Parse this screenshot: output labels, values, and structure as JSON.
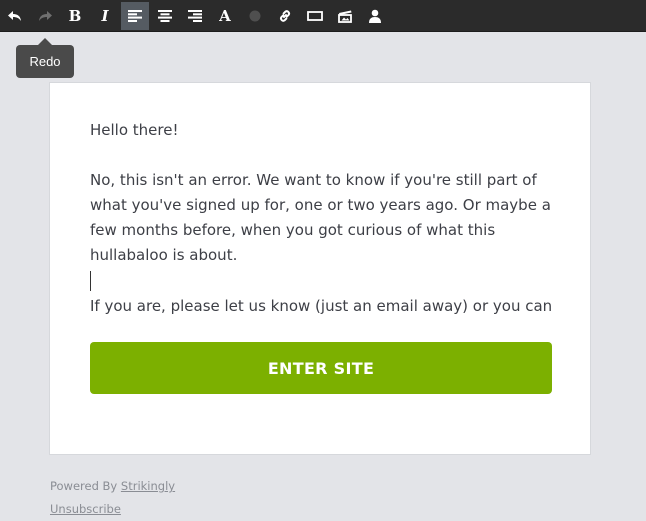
{
  "toolbar": {
    "buttons": [
      {
        "icon": "undo-icon",
        "state": "enabled"
      },
      {
        "icon": "redo-icon",
        "state": "disabled"
      },
      {
        "label": "B",
        "icon": "bold-icon"
      },
      {
        "label": "I",
        "icon": "italic-icon"
      },
      {
        "icon": "align-left-icon",
        "state": "active"
      },
      {
        "icon": "align-center-icon"
      },
      {
        "icon": "align-right-icon"
      },
      {
        "label": "A",
        "icon": "font-size-icon"
      },
      {
        "icon": "text-color-icon"
      },
      {
        "icon": "link-icon"
      },
      {
        "icon": "button-icon"
      },
      {
        "icon": "image-icon"
      },
      {
        "icon": "user-icon"
      }
    ],
    "text_color_swatch": "#4f4f4f"
  },
  "tooltip": {
    "label": "Redo"
  },
  "email": {
    "greeting": "Hello there!",
    "paragraph_lines": [
      "No, this isn't an error. We want to know if you're still part of",
      "what you've signed up for, one or two years ago. Or maybe a",
      "few months before, when you got curious of what this",
      "hullabaloo is about."
    ],
    "second_line": "If  you are, please let us know (just an email away) or you can",
    "cta_label": "ENTER SITE"
  },
  "footer": {
    "powered_by": "Powered By",
    "brand_link": "Strikingly",
    "unsubscribe": "Unsubscribe"
  },
  "colors": {
    "toolbar_bg": "#2b2b2b",
    "page_bg": "#e3e4e8",
    "cta_bg": "#7cb000",
    "text": "#3d3f46"
  }
}
